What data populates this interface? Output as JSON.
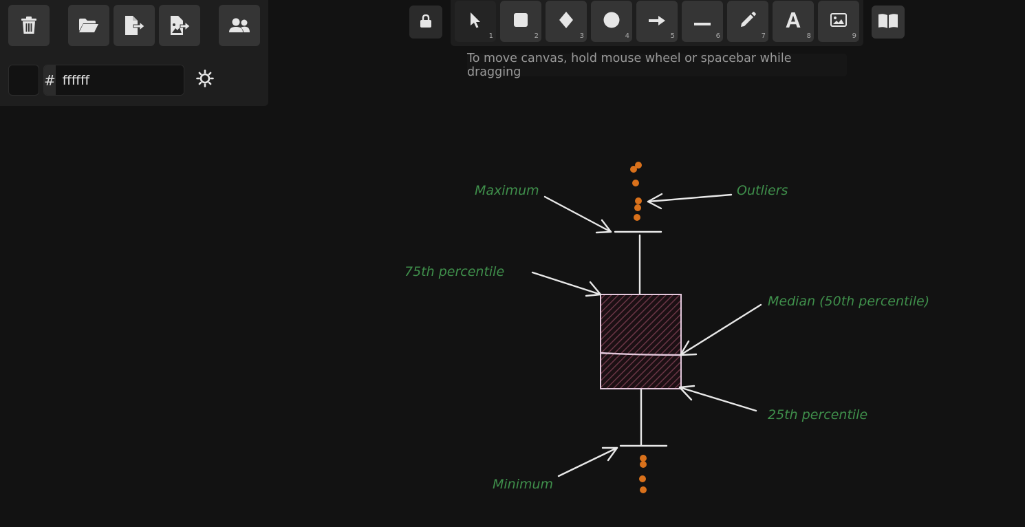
{
  "left_panel": {
    "buttons": [
      {
        "name": "clear-canvas",
        "icon": "trash-icon"
      },
      {
        "name": "open",
        "icon": "folder-open-icon"
      },
      {
        "name": "export",
        "icon": "file-export-icon"
      },
      {
        "name": "export-image",
        "icon": "image-export-icon"
      },
      {
        "name": "collaborate",
        "icon": "users-icon"
      }
    ],
    "background_color": {
      "swatch": "#121212",
      "prefix": "#",
      "value": "ffffff"
    },
    "theme_toggle_icon": "sun-icon"
  },
  "toolbar": {
    "lock_icon": "lock-icon",
    "tools": [
      {
        "name": "selection",
        "icon": "pointer-icon",
        "key": "1"
      },
      {
        "name": "rectangle",
        "icon": "square-icon",
        "key": "2"
      },
      {
        "name": "diamond",
        "icon": "diamond-icon",
        "key": "3"
      },
      {
        "name": "ellipse",
        "icon": "circle-icon",
        "key": "4"
      },
      {
        "name": "arrow",
        "icon": "arrow-right-icon",
        "key": "5"
      },
      {
        "name": "line",
        "icon": "line-icon",
        "key": "6"
      },
      {
        "name": "draw",
        "icon": "pencil-icon",
        "key": "7"
      },
      {
        "name": "text",
        "icon": "text-icon",
        "key": "8"
      },
      {
        "name": "image",
        "icon": "image-icon",
        "key": "9"
      }
    ],
    "library_icon": "book-open-icon",
    "hint": "To move canvas, hold mouse wheel or spacebar while dragging"
  },
  "canvas": {
    "labels": {
      "maximum": "Maximum",
      "outliers": "Outliers",
      "p75": "75th percentile",
      "median": "Median (50th percentile)",
      "p25": "25th percentile",
      "minimum": "Minimum"
    },
    "colors": {
      "label": "#3f8f4b",
      "outlier": "#d9711b",
      "box_stroke": "#e3c8dc",
      "box_hatch": "#6a3646",
      "stroke": "#e8e8e8"
    }
  }
}
